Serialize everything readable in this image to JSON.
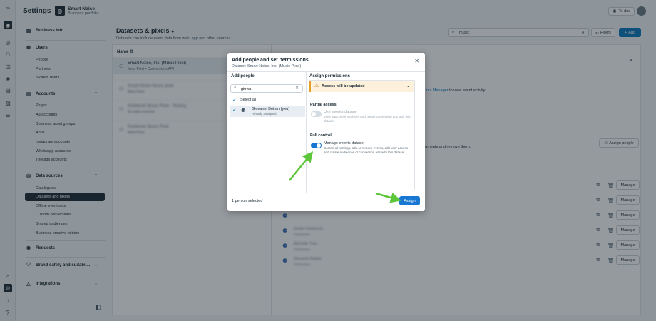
{
  "header": {
    "title": "Settings",
    "business_name": "Smart Noise",
    "business_sub": "Business portfolio",
    "todos": "To-dos"
  },
  "sidebar": {
    "business_info": "Business info",
    "users": "Users",
    "users_items": [
      "People",
      "Partners",
      "System users"
    ],
    "accounts": "Accounts",
    "accounts_items": [
      "Pages",
      "Ad accounts",
      "Business asset groups",
      "Apps",
      "Instagram accounts",
      "WhatsApp accounts",
      "Threads accounts"
    ],
    "data_sources": "Data sources",
    "data_sources_items": [
      "Catalogues",
      "Datasets and pixels",
      "Offline event sets",
      "Custom conversions",
      "Shared audiences",
      "Business creative folders"
    ],
    "requests": "Requests",
    "brand_safety": "Brand safety and suitabil...",
    "integrations": "Integrations"
  },
  "main": {
    "title": "Datasets & pixels",
    "subtitle": "Datasets can include event data from web, app and other sources.",
    "search_value": "music",
    "filters": "Filters",
    "add": "Add",
    "name_col": "Name",
    "rows": [
      {
        "name": "Smart Noise, Inc. (Music Pixel)",
        "sub": "Meta Pixel • Conversions API"
      },
      {
        "name": "Smart Noise Music pixel",
        "sub": "Meta Pixel"
      },
      {
        "name": "Notebook Music Pixel - Testing",
        "sub": "No data received"
      },
      {
        "name": "Notebook Music Pixel",
        "sub": "Meta Pixel"
      }
    ]
  },
  "detail": {
    "events_manager_pre": "",
    "events_manager_link": "nts Manager",
    "events_manager_post": " to view event activity",
    "assign_text": "ignments and remove them.",
    "assign_people": "Assign people",
    "manage": "Manage",
    "people": [
      {
        "name": "",
        "role": ""
      },
      {
        "name": "",
        "role": ""
      },
      {
        "name": "",
        "role": ""
      },
      {
        "name": "Kristin Parkinson",
        "role": "Full access"
      },
      {
        "name": "Michelle Tran",
        "role": "Full access"
      },
      {
        "name": "Giovanni Bottan",
        "role": "Full access"
      }
    ]
  },
  "modal": {
    "title": "Add people and set permissions",
    "subtitle": "Dataset: Smart Noise, Inc. (Music Pixel)",
    "add_people": "Add people",
    "assign_permissions": "Assign permissions",
    "search_value": "giovan",
    "select_all": "Select all",
    "person_name": "Giovanni Bottan (you)",
    "person_status": "Already assigned",
    "warning": "Access will be updated",
    "partial_access": "Partial access",
    "use_events_name": "Use events dataset",
    "use_events_desc": "View data, view analytics and create conversion ads with this dataset.",
    "full_control": "Full control",
    "manage_events_name": "Manage events dataset",
    "manage_events_desc": "Control all settings, add or remove events, edit user access and create audiences or conversion ads with this dataset.",
    "selected_count": "1 person selected",
    "assign": "Assign"
  },
  "colors": {
    "accent": "#1877d2",
    "arrow": "#5dc63a",
    "warning": "#e5a02a",
    "sidebar_active": "#1c2b33"
  }
}
